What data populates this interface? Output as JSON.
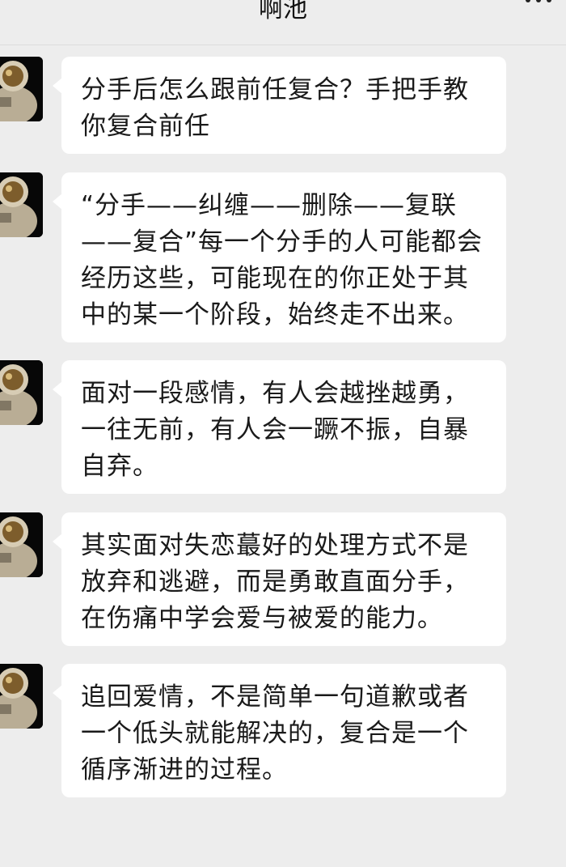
{
  "header": {
    "title": "啊池",
    "more_icon": "more-dots-icon"
  },
  "messages": [
    {
      "sender": "received",
      "avatar_icon": "astronaut-avatar",
      "text": "分手后怎么跟前任复合？手把手教你复合前任"
    },
    {
      "sender": "received",
      "avatar_icon": "astronaut-avatar",
      "text": "“分手——纠缠——删除——复联——复合”每一个分手的人可能都会经历这些，可能现在的你正处于其中的某一个阶段，始终走不出来。"
    },
    {
      "sender": "received",
      "avatar_icon": "astronaut-avatar",
      "text": "面对一段感情，有人会越挫越勇，一往无前，有人会一蹶不振，自暴自弃。"
    },
    {
      "sender": "received",
      "avatar_icon": "astronaut-avatar",
      "text": "其实面对失恋蕞好的处理方式不是放弃和逃避，而是勇敢直面分手，在伤痛中学会爱与被爱的能力。"
    },
    {
      "sender": "received",
      "avatar_icon": "astronaut-avatar",
      "text": "追回爱情，不是简单一句道歉或者一个低头就能解决的，复合是一个循序渐进的过程。"
    }
  ],
  "colors": {
    "background": "#ededed",
    "bubble": "#ffffff",
    "text": "#1a1a1a"
  }
}
